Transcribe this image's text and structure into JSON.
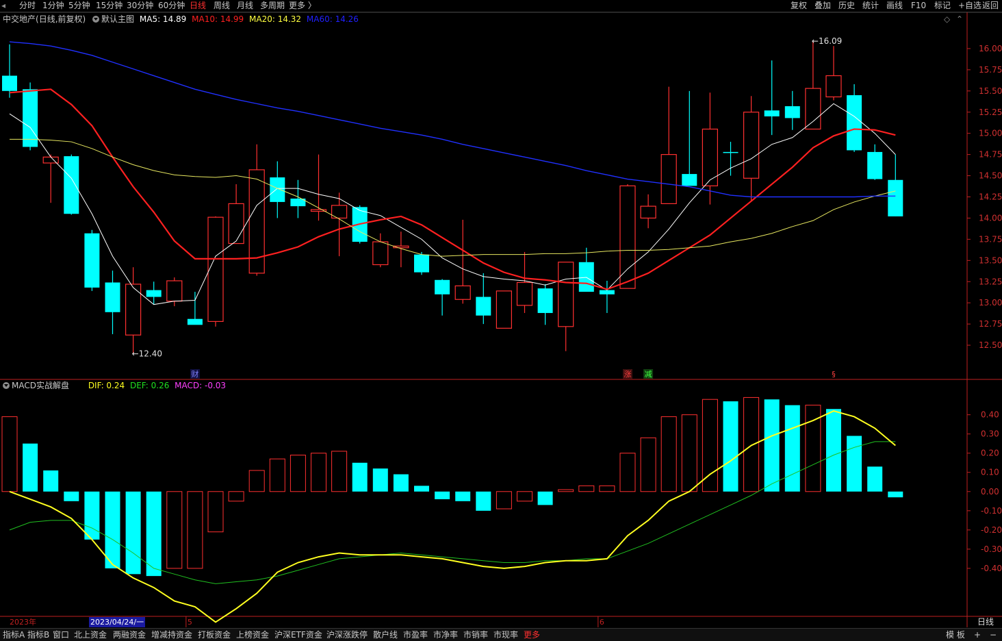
{
  "toolbar": {
    "periods": [
      "分时",
      "1分钟",
      "5分钟",
      "15分钟",
      "30分钟",
      "60分钟",
      "日线",
      "周线",
      "月线",
      "多周期",
      "更多 〉"
    ],
    "active_period": "日线",
    "right": [
      "复权",
      "叠加",
      "历史",
      "统计",
      "画线",
      "F10",
      "标记",
      "+自选",
      "返回"
    ]
  },
  "main_chart": {
    "stock_name": "中交地产",
    "period_label": "(日线,前复权)",
    "indicator_name": "默认主图",
    "ma": [
      {
        "label": "MA5: 14.89",
        "color": "#ffffff"
      },
      {
        "label": "MA10: 14.99",
        "color": "#ff2020"
      },
      {
        "label": "MA20: 14.32",
        "color": "#ffff40"
      },
      {
        "label": "MA60: 14.26",
        "color": "#2020ff"
      }
    ],
    "max_label": "16.09",
    "min_label": "12.40",
    "markers": [
      {
        "text": "财",
        "color": "#8080ff",
        "bg": "#101040",
        "bar": 9
      },
      {
        "text": "涨",
        "color": "#ff4040",
        "bg": "#401010",
        "bar": 30
      },
      {
        "text": "减",
        "color": "#40ff40",
        "bg": "#104010",
        "bar": 31
      },
      {
        "text": "§",
        "color": "#ff4040",
        "bg": "#000000",
        "bar": 40
      }
    ]
  },
  "macd_panel": {
    "title": "MACD实战解盘",
    "dif_label": "DIF: 0.24",
    "dea_label": "DEF: 0.26",
    "macd_label": "MACD: -0.03"
  },
  "time_axis": {
    "year_label": "2023年",
    "cursor_date": "2023/04/24/一",
    "month_labels": [
      {
        "text": "5",
        "bar": 9
      },
      {
        "text": "6",
        "bar": 29
      }
    ]
  },
  "bottom_tabs": [
    "指标A",
    "指标B",
    "窗口",
    "北上资金",
    "两融资金",
    "增减持资金",
    "打板资金",
    "上榜资金",
    "沪深ETF资金",
    "沪深涨跌停",
    "散户线",
    "市盈率",
    "市净率",
    "市销率",
    "市现率",
    "更多"
  ],
  "bottom_right": [
    "模 板",
    "+",
    "−"
  ],
  "period_type_label": "日线",
  "colors": {
    "up": "#ff3030",
    "down": "#00ffff",
    "ma5": "#ffffff",
    "ma10": "#ff2020",
    "ma20": "#e8e860",
    "ma60": "#2030ff",
    "dif": "#ffff20",
    "dea": "#20c020",
    "axis_red": "#c02020"
  },
  "chart_data": [
    {
      "type": "candlestick",
      "title": "中交地产 (日线,前复权)",
      "y_ticks": [
        16.0,
        15.75,
        15.5,
        15.25,
        15.0,
        14.75,
        14.5,
        14.25,
        14.0,
        13.75,
        13.5,
        13.25,
        13.0,
        12.75,
        12.5
      ],
      "ylim": [
        12.25,
        16.25
      ],
      "series": [
        {
          "name": "K线",
          "candles": [
            {
              "o": 15.68,
              "h": 16.05,
              "l": 15.42,
              "c": 15.5
            },
            {
              "o": 15.52,
              "h": 15.6,
              "l": 14.8,
              "c": 14.84
            },
            {
              "o": 14.65,
              "h": 14.75,
              "l": 14.18,
              "c": 14.72
            },
            {
              "o": 14.73,
              "h": 14.75,
              "l": 14.04,
              "c": 14.05
            },
            {
              "o": 13.82,
              "h": 13.86,
              "l": 13.14,
              "c": 13.18
            },
            {
              "o": 13.24,
              "h": 13.38,
              "l": 12.63,
              "c": 12.89
            },
            {
              "o": 12.62,
              "h": 13.42,
              "l": 12.4,
              "c": 13.22
            },
            {
              "o": 13.15,
              "h": 13.25,
              "l": 12.98,
              "c": 13.07
            },
            {
              "o": 13.02,
              "h": 13.3,
              "l": 12.96,
              "c": 13.26
            },
            {
              "o": 12.81,
              "h": 13.13,
              "l": 12.77,
              "c": 12.74
            },
            {
              "o": 12.78,
              "h": 14.02,
              "l": 12.72,
              "c": 14.01
            },
            {
              "o": 13.7,
              "h": 14.4,
              "l": 13.7,
              "c": 14.17
            },
            {
              "o": 13.35,
              "h": 14.87,
              "l": 13.32,
              "c": 14.57
            },
            {
              "o": 14.48,
              "h": 14.67,
              "l": 14.0,
              "c": 14.19
            },
            {
              "o": 14.23,
              "h": 14.45,
              "l": 14.0,
              "c": 14.14
            },
            {
              "o": 14.08,
              "h": 14.75,
              "l": 13.97,
              "c": 14.1
            },
            {
              "o": 14.0,
              "h": 14.3,
              "l": 13.55,
              "c": 14.15
            },
            {
              "o": 14.13,
              "h": 14.15,
              "l": 13.7,
              "c": 13.72
            },
            {
              "o": 13.45,
              "h": 13.82,
              "l": 13.42,
              "c": 13.72
            },
            {
              "o": 13.65,
              "h": 13.84,
              "l": 13.42,
              "c": 13.67
            },
            {
              "o": 13.57,
              "h": 13.6,
              "l": 13.33,
              "c": 13.36
            },
            {
              "o": 13.27,
              "h": 13.28,
              "l": 12.85,
              "c": 13.1
            },
            {
              "o": 13.04,
              "h": 13.98,
              "l": 12.99,
              "c": 13.2
            },
            {
              "o": 13.07,
              "h": 13.35,
              "l": 12.75,
              "c": 12.85
            },
            {
              "o": 12.7,
              "h": 13.12,
              "l": 12.7,
              "c": 13.14
            },
            {
              "o": 12.97,
              "h": 13.6,
              "l": 12.88,
              "c": 13.24
            },
            {
              "o": 13.17,
              "h": 13.22,
              "l": 12.74,
              "c": 12.88
            },
            {
              "o": 12.72,
              "h": 13.45,
              "l": 12.43,
              "c": 13.48
            },
            {
              "o": 13.48,
              "h": 13.65,
              "l": 13.15,
              "c": 13.13
            },
            {
              "o": 13.15,
              "h": 13.26,
              "l": 12.88,
              "c": 13.1
            },
            {
              "o": 13.17,
              "h": 14.4,
              "l": 13.17,
              "c": 14.38
            },
            {
              "o": 14.0,
              "h": 14.28,
              "l": 13.88,
              "c": 14.14
            },
            {
              "o": 14.17,
              "h": 15.55,
              "l": 14.17,
              "c": 14.75
            },
            {
              "o": 14.52,
              "h": 15.5,
              "l": 14.4,
              "c": 14.38
            },
            {
              "o": 14.38,
              "h": 15.48,
              "l": 14.16,
              "c": 15.05
            },
            {
              "o": 14.78,
              "h": 14.9,
              "l": 14.5,
              "c": 14.77
            },
            {
              "o": 14.47,
              "h": 15.44,
              "l": 14.2,
              "c": 15.25
            },
            {
              "o": 15.27,
              "h": 15.86,
              "l": 14.98,
              "c": 15.2
            },
            {
              "o": 15.32,
              "h": 15.5,
              "l": 15.04,
              "c": 15.18
            },
            {
              "o": 15.05,
              "h": 16.09,
              "l": 15.05,
              "c": 15.53
            },
            {
              "o": 15.43,
              "h": 16.03,
              "l": 15.39,
              "c": 15.68
            },
            {
              "o": 15.45,
              "h": 15.58,
              "l": 14.78,
              "c": 14.8
            },
            {
              "o": 14.78,
              "h": 14.87,
              "l": 14.45,
              "c": 14.46
            },
            {
              "o": 14.45,
              "h": 14.75,
              "l": 14.02,
              "c": 14.02
            }
          ]
        },
        {
          "name": "MA5",
          "values": [
            15.23,
            15.07,
            14.72,
            14.47,
            14.05,
            13.55,
            13.18,
            12.98,
            13.02,
            13.03,
            13.55,
            13.73,
            14.15,
            14.35,
            14.35,
            14.28,
            14.23,
            14.09,
            14.03,
            13.89,
            13.75,
            13.53,
            13.4,
            13.31,
            13.28,
            13.26,
            13.21,
            13.28,
            13.3,
            13.15,
            13.4,
            13.6,
            13.87,
            14.18,
            14.45,
            14.59,
            14.7,
            14.87,
            14.95,
            15.14,
            15.35,
            15.2,
            15.0,
            14.75
          ]
        },
        {
          "name": "MA10",
          "values": [
            15.48,
            15.5,
            15.52,
            15.34,
            15.09,
            14.72,
            14.37,
            14.07,
            13.73,
            13.52,
            13.52,
            13.52,
            13.53,
            13.59,
            13.66,
            13.78,
            13.87,
            13.93,
            13.98,
            14.02,
            13.92,
            13.77,
            13.62,
            13.47,
            13.36,
            13.29,
            13.27,
            13.24,
            13.23,
            13.16,
            13.25,
            13.35,
            13.5,
            13.65,
            13.8,
            14.0,
            14.2,
            14.4,
            14.6,
            14.83,
            14.97,
            15.05,
            15.04,
            14.98
          ]
        },
        {
          "name": "MA20",
          "values": [
            14.93,
            14.93,
            14.92,
            14.9,
            14.82,
            14.72,
            14.63,
            14.56,
            14.51,
            14.49,
            14.48,
            14.5,
            14.46,
            14.35,
            14.25,
            14.12,
            13.99,
            13.84,
            13.72,
            13.64,
            13.57,
            13.55,
            13.56,
            13.57,
            13.57,
            13.57,
            13.58,
            13.58,
            13.59,
            13.61,
            13.62,
            13.62,
            13.63,
            13.65,
            13.67,
            13.72,
            13.76,
            13.82,
            13.9,
            13.97,
            14.1,
            14.19,
            14.26,
            14.32
          ]
        },
        {
          "name": "MA60",
          "values": [
            16.08,
            16.06,
            16.03,
            15.98,
            15.92,
            15.84,
            15.76,
            15.68,
            15.6,
            15.52,
            15.46,
            15.4,
            15.35,
            15.3,
            15.26,
            15.21,
            15.16,
            15.11,
            15.06,
            15.02,
            14.98,
            14.93,
            14.87,
            14.82,
            14.77,
            14.72,
            14.67,
            14.62,
            14.56,
            14.51,
            14.46,
            14.43,
            14.4,
            14.37,
            14.32,
            14.27,
            14.25,
            14.25,
            14.25,
            14.25,
            14.25,
            14.25,
            14.26,
            14.26
          ]
        }
      ]
    },
    {
      "type": "bar",
      "title": "MACD实战解盘",
      "y_ticks": [
        0.4,
        0.3,
        0.2,
        0.1,
        0.0,
        -0.1,
        -0.2,
        -0.3,
        -0.4
      ],
      "ylim": [
        -0.65,
        0.52
      ],
      "series": [
        {
          "name": "MACD",
          "values": [
            0.39,
            0.25,
            0.11,
            -0.05,
            -0.25,
            -0.4,
            -0.43,
            -0.44,
            -0.4,
            -0.4,
            -0.21,
            -0.05,
            0.11,
            0.17,
            0.19,
            0.2,
            0.21,
            0.15,
            0.12,
            0.09,
            0.03,
            -0.04,
            -0.05,
            -0.1,
            -0.09,
            -0.05,
            -0.07,
            0.01,
            0.03,
            0.03,
            0.2,
            0.28,
            0.39,
            0.4,
            0.48,
            0.47,
            0.49,
            0.48,
            0.45,
            0.45,
            0.43,
            0.29,
            0.13,
            -0.03
          ]
        },
        {
          "name": "DIF",
          "values": [
            0.0,
            -0.04,
            -0.08,
            -0.14,
            -0.25,
            -0.38,
            -0.45,
            -0.5,
            -0.57,
            -0.6,
            -0.68,
            -0.61,
            -0.53,
            -0.42,
            -0.37,
            -0.34,
            -0.32,
            -0.33,
            -0.33,
            -0.33,
            -0.34,
            -0.35,
            -0.37,
            -0.39,
            -0.4,
            -0.39,
            -0.37,
            -0.36,
            -0.36,
            -0.35,
            -0.23,
            -0.15,
            -0.05,
            0.0,
            0.09,
            0.16,
            0.24,
            0.29,
            0.33,
            0.37,
            0.42,
            0.39,
            0.33,
            0.24
          ]
        },
        {
          "name": "DEA",
          "values": [
            -0.2,
            -0.16,
            -0.15,
            -0.15,
            -0.19,
            -0.25,
            -0.32,
            -0.4,
            -0.43,
            -0.46,
            -0.48,
            -0.47,
            -0.46,
            -0.44,
            -0.41,
            -0.38,
            -0.35,
            -0.34,
            -0.33,
            -0.32,
            -0.33,
            -0.34,
            -0.35,
            -0.36,
            -0.37,
            -0.37,
            -0.36,
            -0.36,
            -0.35,
            -0.35,
            -0.31,
            -0.27,
            -0.22,
            -0.17,
            -0.12,
            -0.07,
            -0.02,
            0.04,
            0.09,
            0.14,
            0.19,
            0.23,
            0.26,
            0.26
          ]
        }
      ]
    }
  ]
}
